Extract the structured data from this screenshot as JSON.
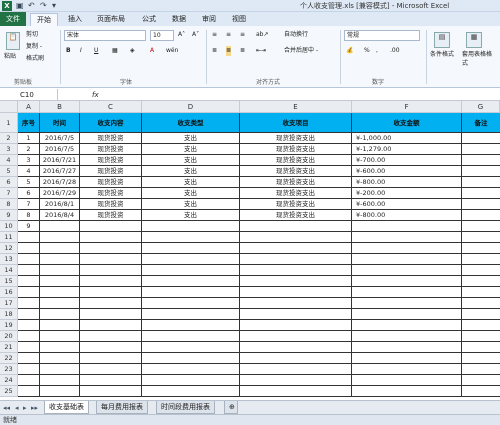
{
  "window": {
    "title": "个人收支管理.xls  [兼容模式]  -  Microsoft Excel",
    "app_icon": "X"
  },
  "ribbon_tabs": [
    "文件",
    "开始",
    "插入",
    "页面布局",
    "公式",
    "数据",
    "审阅",
    "视图"
  ],
  "ribbon": {
    "paste_label": "粘贴",
    "cut_label": "剪切",
    "copy_label": "复制 -",
    "format_painter_label": "格式刷",
    "clipboard_group": "剪贴板",
    "font_name": "宋体",
    "font_size": "10",
    "font_group": "字体",
    "bold": "B",
    "italic": "I",
    "underline": "U",
    "wrap_text_label": "自动换行",
    "merge_center_label": "合并后居中 -",
    "alignment_group": "对齐方式",
    "number_format": "常规",
    "number_group": "数字",
    "conditional_format_label": "条件格式",
    "format_table_label": "套用表格格式",
    "percent": "%",
    "comma": ","
  },
  "formula_bar": {
    "name_box": "C10",
    "fx": "fx",
    "formula": ""
  },
  "columns": [
    "A",
    "B",
    "C",
    "D",
    "E",
    "F",
    "G"
  ],
  "table": {
    "headers": [
      "序号",
      "时间",
      "收支内容",
      "收支类型",
      "收支项目",
      "收支金额",
      "备注"
    ],
    "rows": [
      [
        "1",
        "2016/7/5",
        "现货投资",
        "支出",
        "现货投资支出",
        "¥-1,000.00",
        ""
      ],
      [
        "2",
        "2016/7/5",
        "现货投资",
        "支出",
        "现货投资支出",
        "¥-1,279.00",
        ""
      ],
      [
        "3",
        "2016/7/21",
        "现货投资",
        "支出",
        "现货投资支出",
        "¥-700.00",
        ""
      ],
      [
        "4",
        "2016/7/27",
        "现货投资",
        "支出",
        "现货投资支出",
        "¥-600.00",
        ""
      ],
      [
        "5",
        "2016/7/28",
        "现货投资",
        "支出",
        "现货投资支出",
        "¥-800.00",
        ""
      ],
      [
        "6",
        "2016/7/29",
        "现货投资",
        "支出",
        "现货投资支出",
        "¥-200.00",
        ""
      ],
      [
        "7",
        "2016/8/1",
        "现货投资",
        "支出",
        "现货投资支出",
        "¥-600.00",
        ""
      ],
      [
        "8",
        "2016/8/4",
        "现货投资",
        "支出",
        "现货投资支出",
        "¥-800.00",
        ""
      ],
      [
        "9",
        "",
        "",
        "",
        "",
        "",
        ""
      ]
    ]
  },
  "row_numbers": [
    "1",
    "2",
    "3",
    "4",
    "5",
    "6",
    "7",
    "8",
    "9",
    "10",
    "11",
    "12",
    "13",
    "14",
    "15",
    "16",
    "17",
    "18",
    "19",
    "20",
    "21",
    "22",
    "23",
    "24",
    "25"
  ],
  "sheet_tabs": [
    "收支基础表",
    "每月费用报表",
    "时间段费用报表"
  ],
  "active_sheet": 0,
  "status": "就绪",
  "colors": {
    "header_fill": "#00b0f0",
    "file_tab": "#217346"
  }
}
